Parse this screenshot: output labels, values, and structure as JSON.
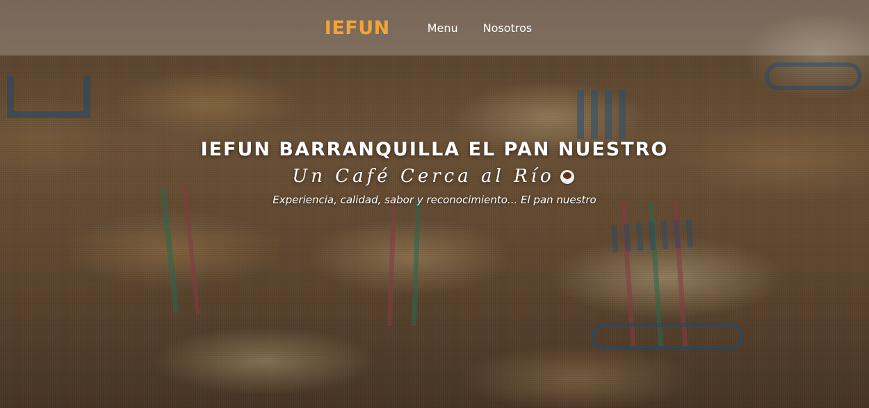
{
  "navbar": {
    "brand": "IEFUN",
    "links": [
      {
        "label": "Menu"
      },
      {
        "label": "Nosotros"
      }
    ]
  },
  "hero": {
    "title": "IEFUN BARRANQUILLA EL PAN NUESTRO",
    "tagline": "Un Café Cerca al Río",
    "tagline_icon": "coffee-cup-icon",
    "subtitle": "Experiencia, calidad, sabor y reconocimiento... El pan nuestro",
    "background_image": "coffee-sacks-photo"
  },
  "colors": {
    "brand": "#f2a43a",
    "text": "#ffffff"
  }
}
